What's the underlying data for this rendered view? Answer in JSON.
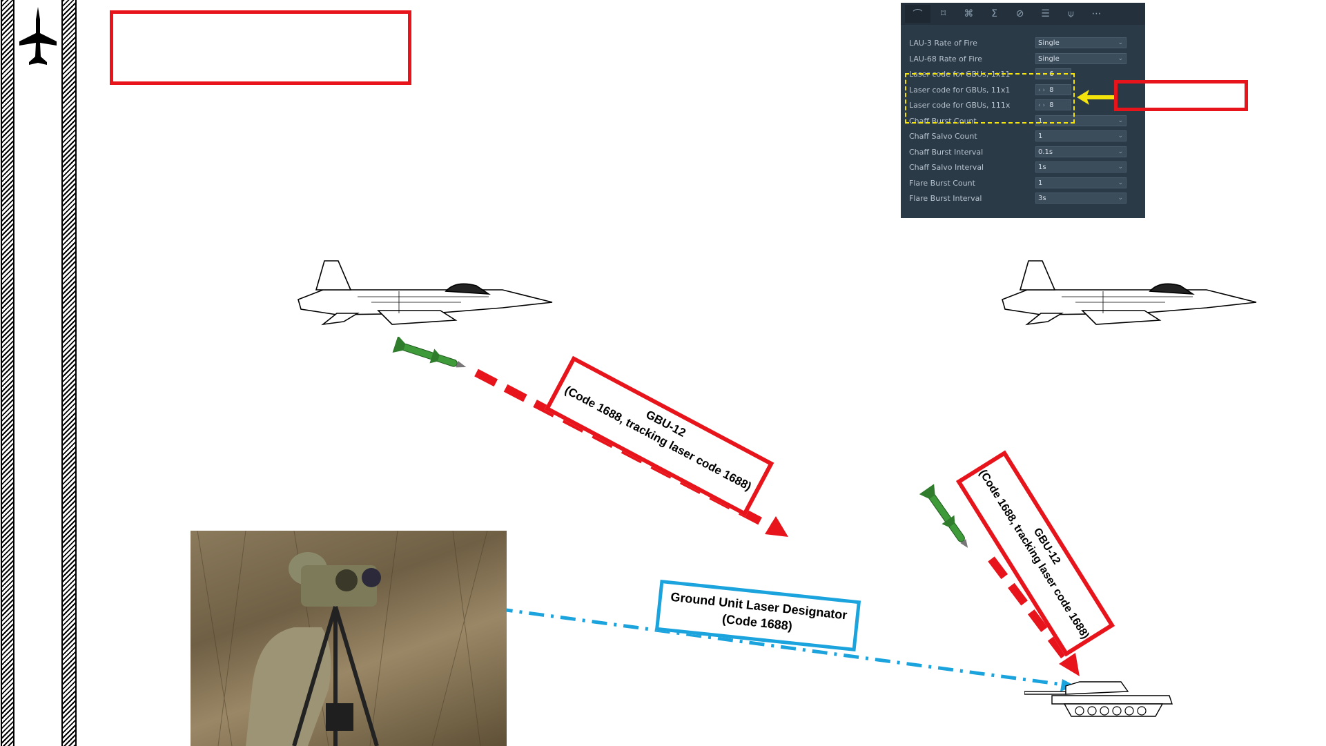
{
  "panel": {
    "tab_icons": [
      "curve-icon",
      "frame-icon",
      "command-icon",
      "sigma-icon",
      "disabled-icon",
      "list-icon",
      "antenna-icon",
      "more-icon"
    ],
    "tab_glyphs": [
      "⌒",
      "⌑",
      "⌘",
      "Σ",
      "⊘",
      "☰",
      "⍦",
      "⋯"
    ],
    "rows": [
      {
        "label": "LAU-3 Rate of Fire",
        "value": "Single",
        "type": "select"
      },
      {
        "label": "LAU-68 Rate of Fire",
        "value": "Single",
        "type": "select"
      },
      {
        "label": "Laser code for GBUs, 1x11",
        "value": "6",
        "type": "number"
      },
      {
        "label": "Laser code for GBUs, 11x1",
        "value": "8",
        "type": "number"
      },
      {
        "label": "Laser code for GBUs, 111x",
        "value": "8",
        "type": "number"
      },
      {
        "label": "Chaff Burst Count",
        "value": "1",
        "type": "select"
      },
      {
        "label": "Chaff Salvo Count",
        "value": "1",
        "type": "select"
      },
      {
        "label": "Chaff Burst Interval",
        "value": "0.1s",
        "type": "select"
      },
      {
        "label": "Chaff Salvo Interval",
        "value": "1s",
        "type": "select"
      },
      {
        "label": "Flare Burst Count",
        "value": "1",
        "type": "select"
      },
      {
        "label": "Flare Burst Interval",
        "value": "3s",
        "type": "select"
      }
    ]
  },
  "callouts": {
    "gbu_left": {
      "line1": "GBU-12",
      "line2": "(Code 1688, tracking laser code 1688)"
    },
    "gbu_right": {
      "line1": "GBU-12",
      "line2": "(Code 1688, tracking laser code 1688)"
    },
    "designator": {
      "line1": "Ground Unit Laser Designator",
      "line2": "(Code 1688)"
    }
  },
  "colors": {
    "red": "#e8141b",
    "blue": "#1aa3dc",
    "yellow": "#f5e30c",
    "panel_bg": "#2b3a47"
  }
}
